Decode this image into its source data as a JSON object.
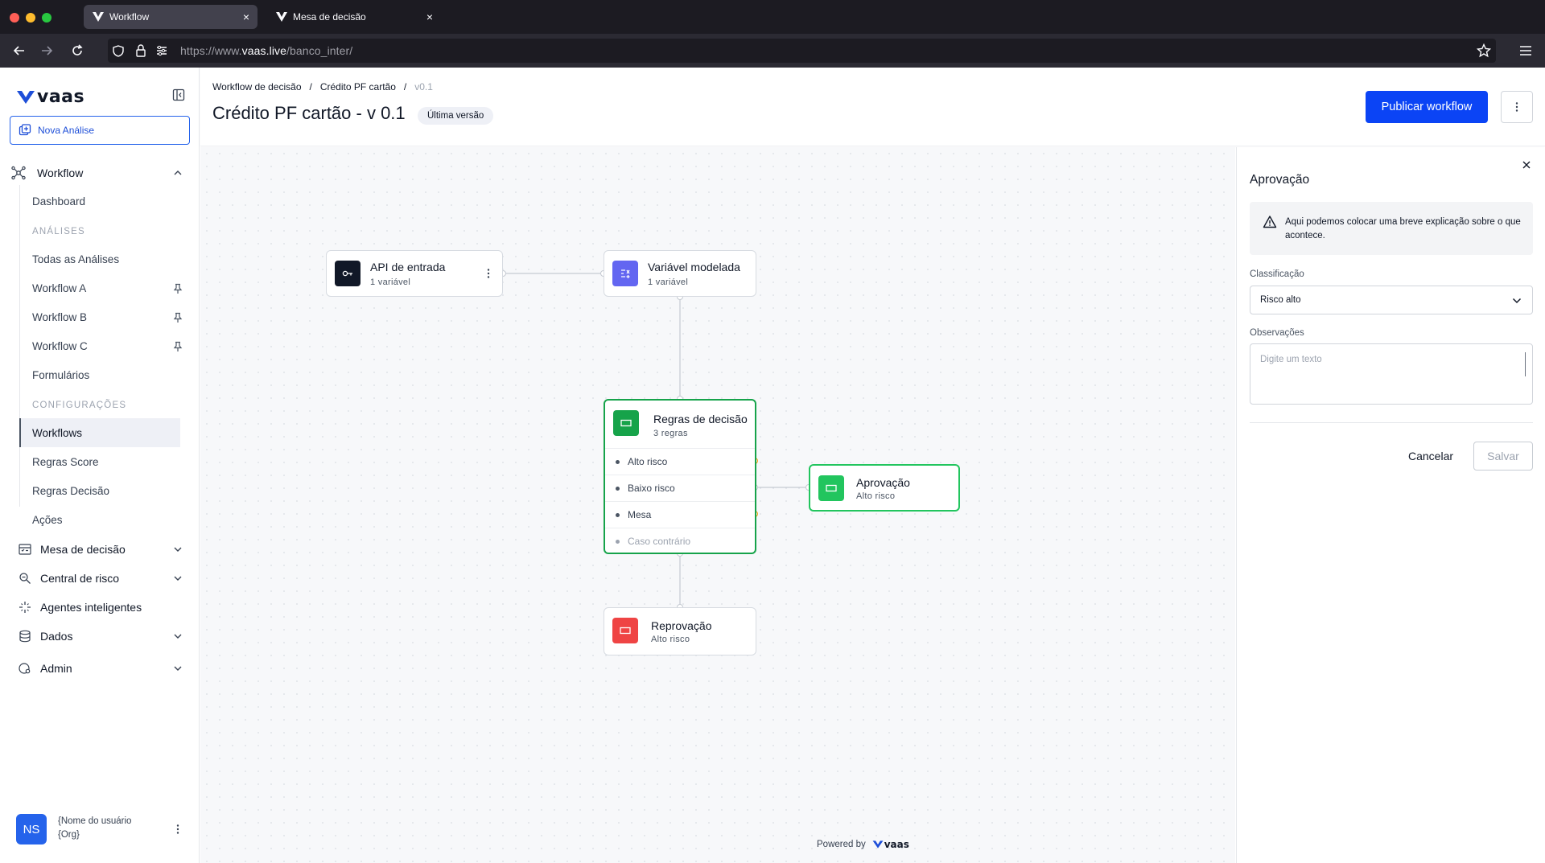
{
  "browser": {
    "tabs": [
      {
        "title": "Workflow",
        "active": true
      },
      {
        "title": "Mesa de decisão",
        "active": false
      }
    ],
    "url_prefix": "https://www.",
    "url_host": "vaas.live",
    "url_path": "/banco_inter/"
  },
  "sidebar": {
    "logo_text": "vaas",
    "new_analysis_label": "Nova Análise",
    "workflow_label": "Workflow",
    "dashboard_label": "Dashboard",
    "analyses_section": "ANÁLISES",
    "analyses_items": [
      "Todas as Análises",
      "Workflow A",
      "Workflow B",
      "Workflow C",
      "Formulários"
    ],
    "config_section": "CONFIGURAÇÕES",
    "config_items": [
      "Workflows",
      "Regras Score",
      "Regras Decisão",
      "Ações"
    ],
    "main_items": [
      "Mesa de decisão",
      "Central de risco",
      "Agentes inteligentes",
      "Dados",
      "Admin"
    ],
    "active_item": "Workflows"
  },
  "user": {
    "initials": "NS",
    "name": "{Nome do usuário",
    "org": "{Org}"
  },
  "header": {
    "breadcrumb": [
      "Workflow de decisão",
      "/",
      "Crédito PF cartão",
      "/",
      "v0.1"
    ],
    "title": "Crédito PF cartão - v 0.1",
    "badge": "Última versão",
    "publish_label": "Publicar workflow"
  },
  "canvas": {
    "nodes": {
      "api": {
        "title": "API de entrada",
        "subtitle": "1 variável"
      },
      "variable": {
        "title": "Variável modelada",
        "subtitle": "1 variável"
      },
      "rules": {
        "title": "Regras de decisão",
        "subtitle": "3 regras",
        "rows": [
          "Alto risco",
          "Baixo risco",
          "Mesa",
          "Caso contrário"
        ]
      },
      "approval": {
        "title": "Aprovação",
        "subtitle": "Alto risco"
      },
      "rejection": {
        "title": "Reprovação",
        "subtitle": "Alto risco"
      }
    },
    "powered_by": "Powered by",
    "powered_logo": "vaas"
  },
  "panel": {
    "title": "Aprovação",
    "alert_text": "Aqui podemos colocar uma breve explicação sobre o que acontece.",
    "classification_label": "Classificação",
    "classification_value": "Risco alto",
    "observations_label": "Observações",
    "observations_placeholder": "Digite um texto",
    "cancel_label": "Cancelar",
    "save_label": "Salvar"
  },
  "colors": {
    "primary": "#0b44f5",
    "success": "#16a34a",
    "danger": "#ef4444",
    "variable": "#6366f1",
    "warning_handle": "#f59e0b"
  }
}
